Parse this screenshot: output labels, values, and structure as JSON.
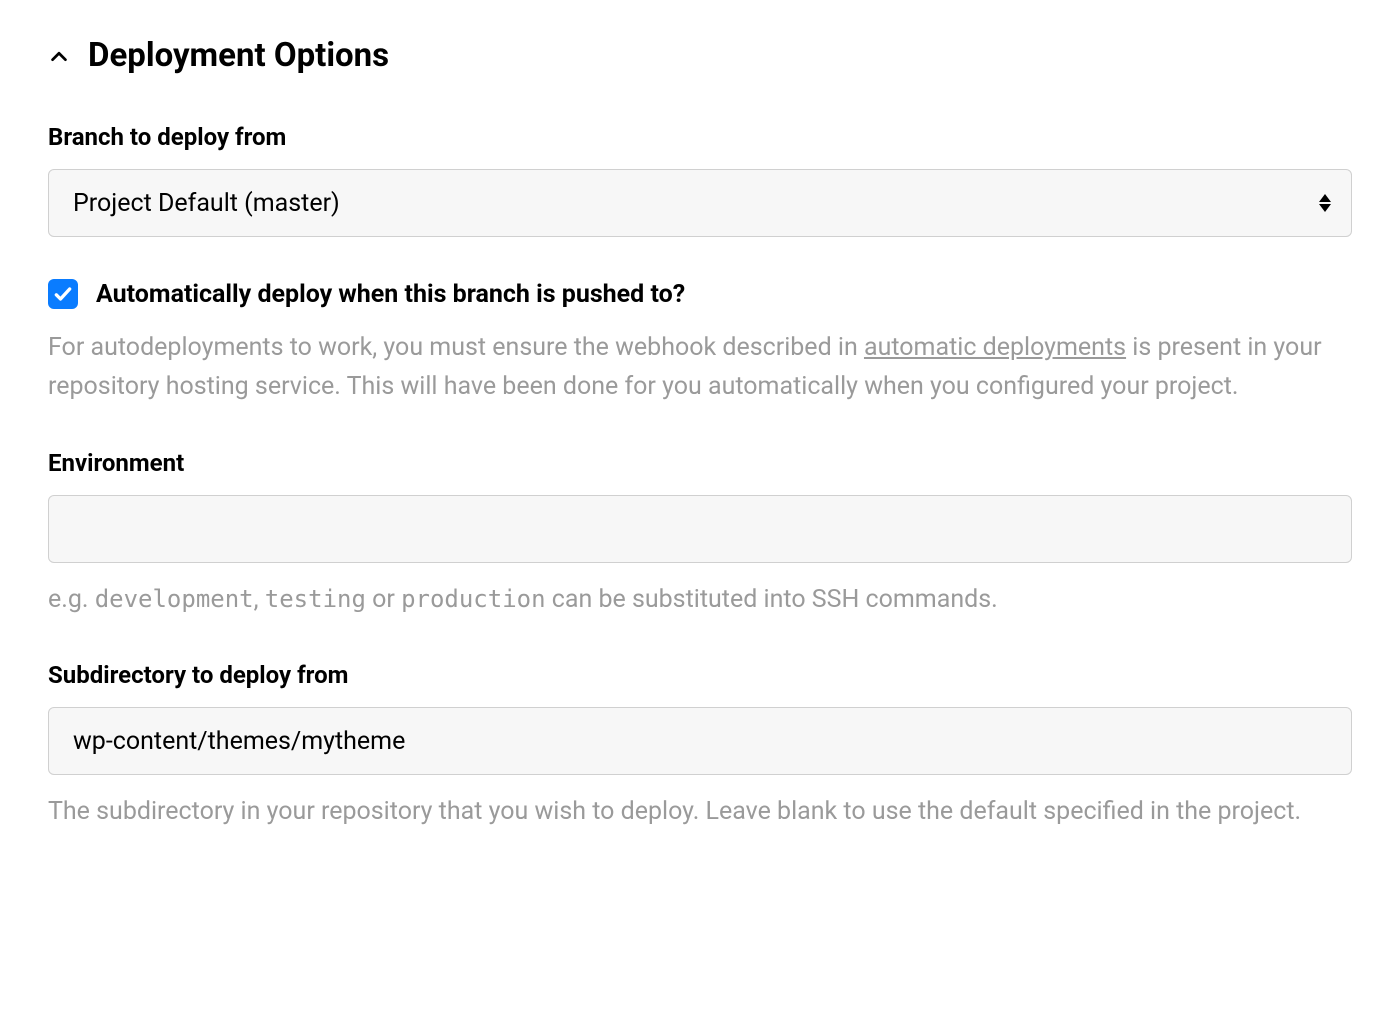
{
  "section": {
    "title": "Deployment Options"
  },
  "branch": {
    "label": "Branch to deploy from",
    "selected": "Project Default (master)"
  },
  "autodeploy": {
    "checked": true,
    "label": "Automatically deploy when this branch is pushed to?",
    "help_before": "For autodeployments to work, you must ensure the webhook described in ",
    "help_link": "automatic deployments",
    "help_after": " is present in your repository hosting service. This will have been done for you automatically when you configured your project."
  },
  "environment": {
    "label": "Environment",
    "value": "",
    "help_before": "e.g. ",
    "help_code1": "development",
    "help_sep1": ", ",
    "help_code2": "testing",
    "help_sep2": " or ",
    "help_code3": "production",
    "help_after": " can be substituted into SSH commands."
  },
  "subdirectory": {
    "label": "Subdirectory to deploy from",
    "value": "wp-content/themes/mytheme",
    "help": "The subdirectory in your repository that you wish to deploy. Leave blank to use the default specified in the project."
  }
}
